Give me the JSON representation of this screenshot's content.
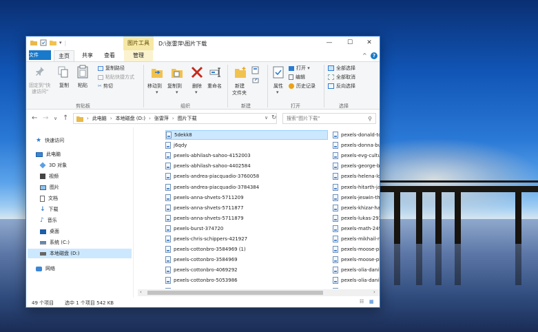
{
  "window": {
    "title": "D:\\张雷萍\\图片下载",
    "context_tab_title": "图片工具",
    "controls": {
      "minimize": "—",
      "maximize": "☐",
      "close": "✕"
    }
  },
  "tabs": {
    "file": "文件",
    "home": "主页",
    "share": "共享",
    "view": "查看",
    "manage": "管理"
  },
  "ribbon": {
    "collapse": "^",
    "help": "?",
    "clipboard": {
      "group_label": "剪贴板",
      "pin_quick": "固定到\"快",
      "pin_quick_2": "速访问\"",
      "copy": "复制",
      "paste": "粘贴",
      "copy_path": "复制路径",
      "paste_shortcut": "粘贴快捷方式",
      "cut": "剪切"
    },
    "organize": {
      "group_label": "组织",
      "move_to": "移动到",
      "copy_to": "复制到",
      "delete": "删除",
      "rename": "重命名"
    },
    "new": {
      "group_label": "新建",
      "new_folder": "新建",
      "new_folder_2": "文件夹"
    },
    "open": {
      "group_label": "打开",
      "properties": "属性",
      "open": "打开",
      "edit": "编辑",
      "history": "历史记录"
    },
    "select": {
      "group_label": "选择",
      "select_all": "全部选择",
      "select_none": "全部取消",
      "invert": "反向选择"
    }
  },
  "addressbar": {
    "back": "←",
    "forward": "→",
    "dropdown": "∨",
    "up": "↑",
    "crumbs": [
      "此电脑",
      "本地磁盘 (D:)",
      "张雷萍",
      "图片下载"
    ],
    "refresh": "↻",
    "search_placeholder": "搜索\"图片下载\""
  },
  "navpane": {
    "items": [
      {
        "label": "快速访问",
        "icon": "star-icon"
      },
      {
        "label": "此电脑",
        "icon": "computer-icon"
      },
      {
        "label": "3D 对象",
        "icon": "cube-icon"
      },
      {
        "label": "视频",
        "icon": "video-icon"
      },
      {
        "label": "图片",
        "icon": "picture-icon"
      },
      {
        "label": "文档",
        "icon": "document-icon"
      },
      {
        "label": "下载",
        "icon": "download-icon"
      },
      {
        "label": "音乐",
        "icon": "music-icon"
      },
      {
        "label": "桌面",
        "icon": "desktop-icon"
      },
      {
        "label": "系统 (C:)",
        "icon": "drive-icon"
      },
      {
        "label": "本地磁盘 (D:)",
        "icon": "drive-icon"
      },
      {
        "label": "网络",
        "icon": "network-icon"
      }
    ]
  },
  "files": {
    "col1": [
      "5dekk8",
      "j6qdy",
      "pexels-abhilash-sahoo-4152003",
      "pexels-abhilash-sahoo-4402584",
      "pexels-andrea-piacquadio-3760058",
      "pexels-andrea-piacquadio-3784384",
      "pexels-anna-shvets-5711209",
      "pexels-anna-shvets-5711877",
      "pexels-anna-shvets-5711879",
      "pexels-burst-374720",
      "pexels-chris-schippers-421927",
      "pexels-cottonbro-3584969 (1)",
      "pexels-cottonbro-3584969",
      "pexels-cottonbro-4069292",
      "pexels-cottonbro-5053986",
      "pexels-cottonbro-5053986-removebg-preview"
    ],
    "col2": [
      "pexels-donald-tong-234",
      "pexels-donna-bulika-35",
      "pexels-evg-culture-1174",
      "pexels-george-becker-",
      "pexels-helena-lopes-10",
      "pexels-hitarth-jadhav-22",
      "pexels-jeswin-thomas-7",
      "pexels-khizar-hayat-111",
      "pexels-lukas-293333",
      "pexels-math-249324",
      "pexels-mikhail-nilov-689",
      "pexels-moose-photos-",
      "pexels-moose-photos-1",
      "pexels-olia-danilevich-4",
      "pexels-olia-danilevich-4",
      "pexels-olia-danilevich-4"
    ]
  },
  "status": {
    "count": "49 个项目",
    "selected": "选中 1 个项目  542 KB"
  },
  "colors": {
    "accent": "#1979ca",
    "selection": "#cce8ff",
    "context_tab": "#f6e8a6"
  }
}
